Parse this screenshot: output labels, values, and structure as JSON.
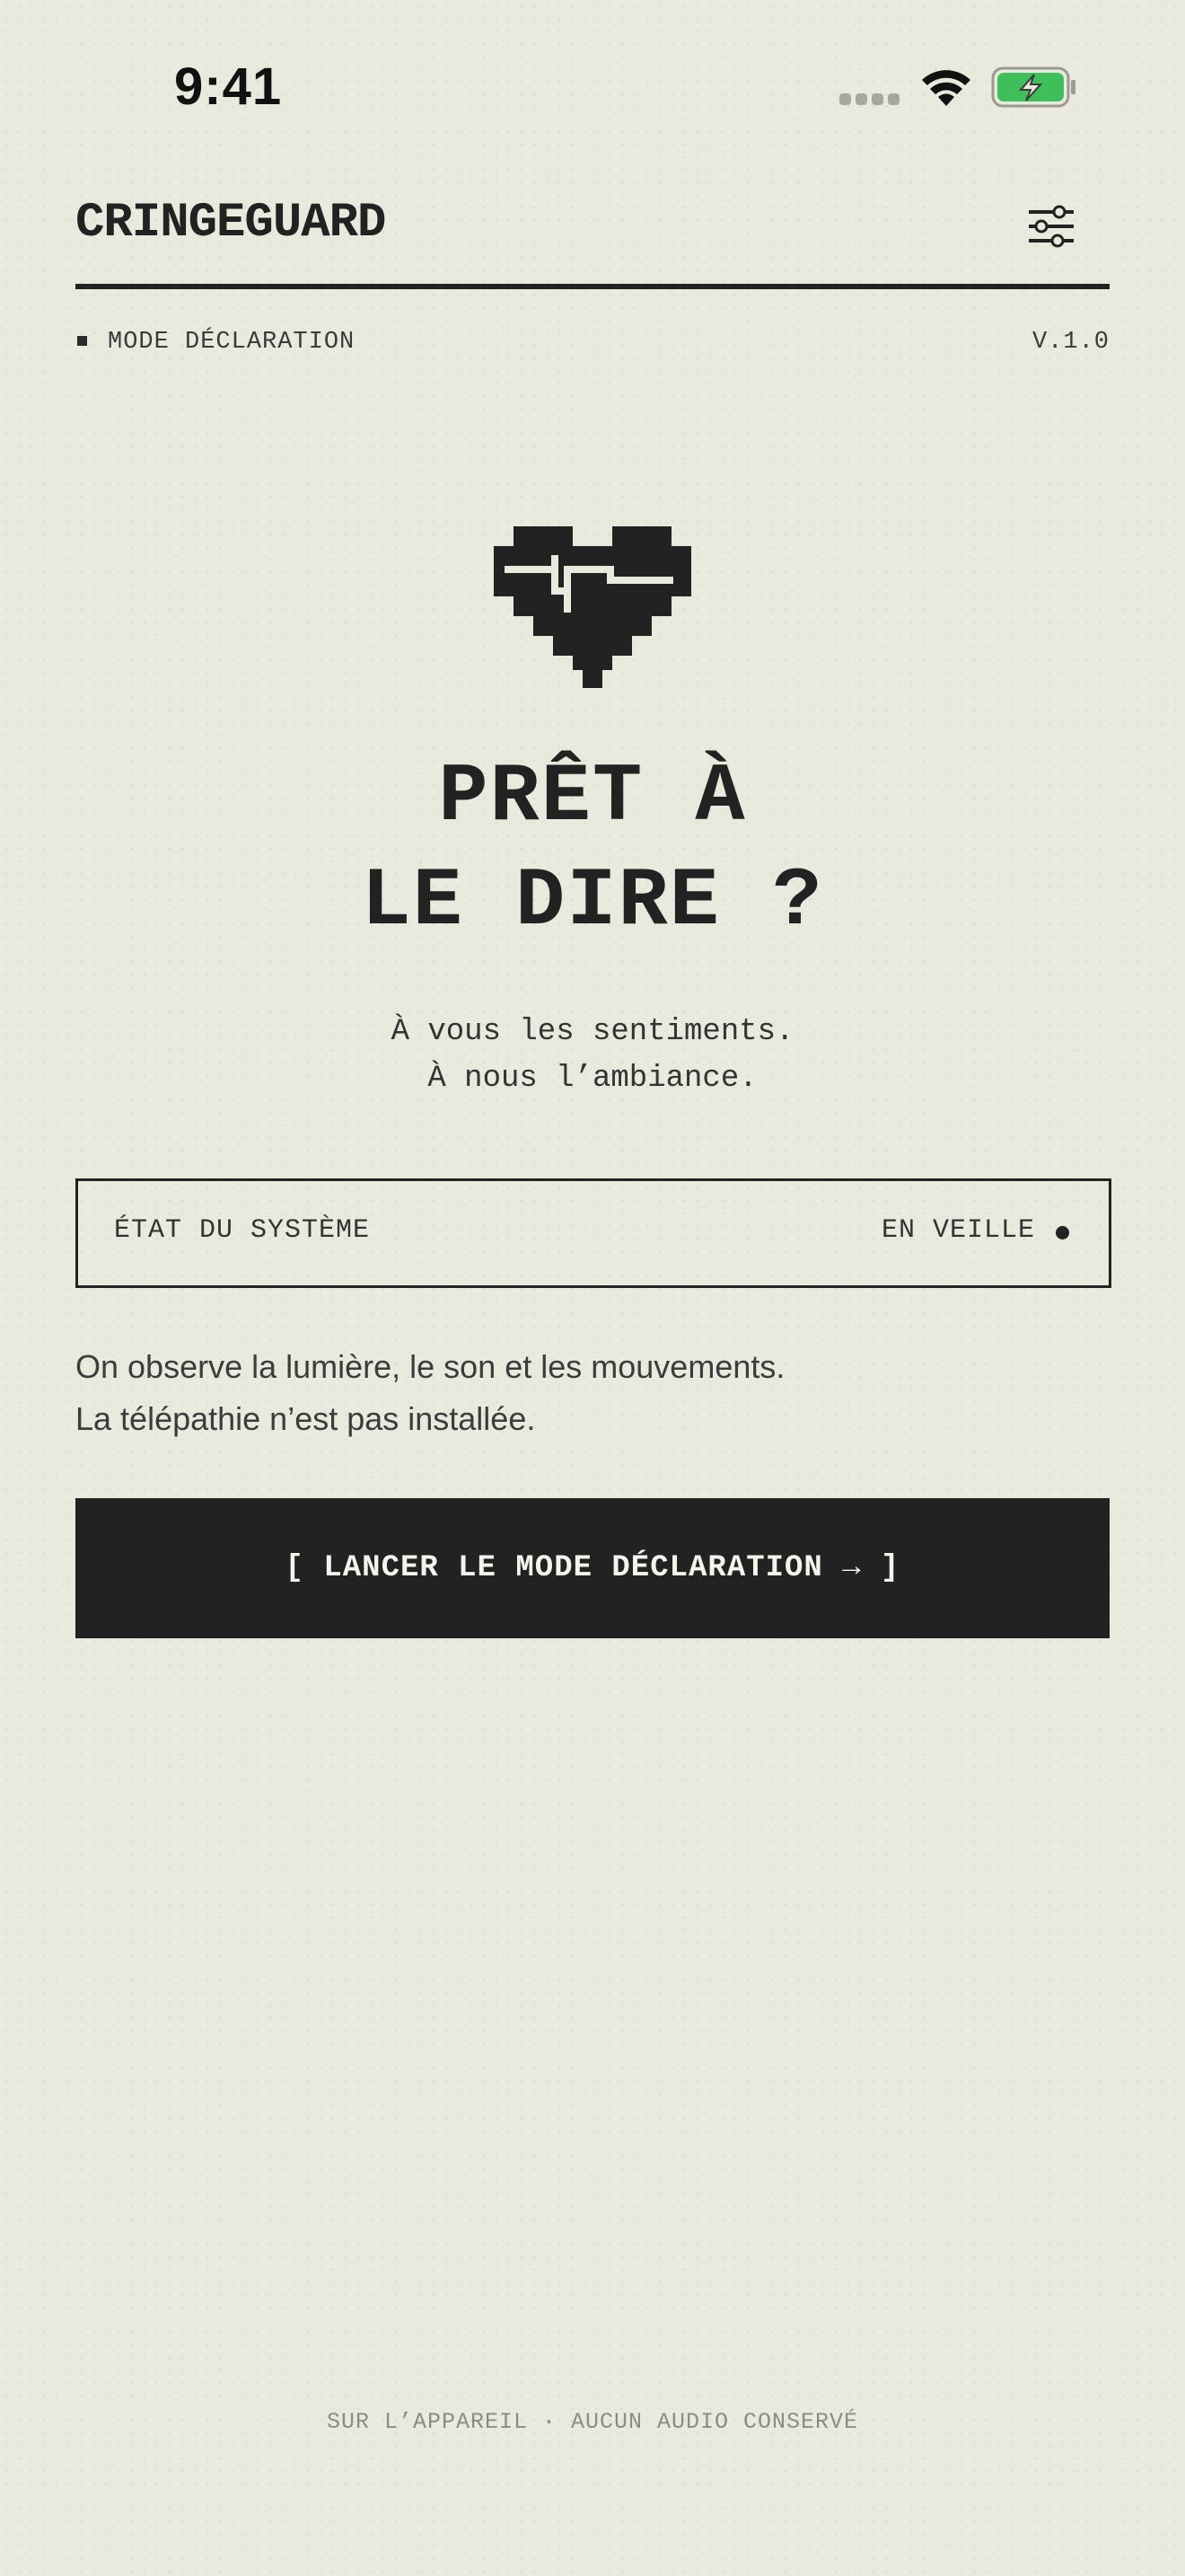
{
  "status_bar": {
    "time": "9:41",
    "signal_icon": "cellular-signal-icon",
    "wifi_icon": "wifi-icon",
    "battery_icon": "battery-charging-icon",
    "battery_color": "#3fbf5a"
  },
  "header": {
    "brand": "CRINGEGUARD",
    "settings_icon": "sliders-icon",
    "mode_label": "MODE DÉCLARATION",
    "version": "V.1.0"
  },
  "hero": {
    "icon": "pixel-heart-pulse-icon",
    "title_line1": "PRÊT À",
    "title_line2": "LE DIRE ?",
    "tagline_line1": "À vous les sentiments.",
    "tagline_line2": "À nous l’ambiance."
  },
  "system_state": {
    "label": "ÉTAT DU SYSTÈME",
    "value": "EN VEILLE"
  },
  "description": {
    "line1": "On observe la lumière, le son et les mouvements.",
    "line2": "La télépathie n’est pas installée."
  },
  "cta": {
    "label": "[ LANCER LE MODE DÉCLARATION → ]"
  },
  "footer": {
    "text": "SUR L’APPAREIL · AUCUN AUDIO CONSERVÉ"
  },
  "colors": {
    "background": "#e9eadd",
    "ink": "#222222",
    "button_text": "#f4f4ec"
  }
}
